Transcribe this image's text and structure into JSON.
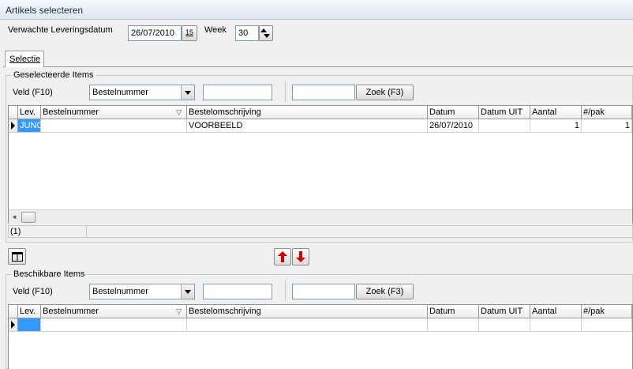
{
  "window": {
    "title": "Artikels selecteren"
  },
  "header": {
    "delivery_label": "Verwachte Leveringsdatum",
    "delivery_value": "26/07/2010",
    "calendar_button": "15",
    "week_label": "Week",
    "week_value": "30"
  },
  "tabs": [
    {
      "label": "Selectie"
    }
  ],
  "selected": {
    "group_title": "Geselecteerde Items",
    "field_label": "Veld (F10)",
    "field_value": "Bestelnummer",
    "search_value": "",
    "search_value2": "",
    "search_button": "Zoek (F3)",
    "columns": [
      "Lev.",
      "Bestelnummer",
      "Bestelomschrijving",
      "Datum",
      "Datum UIT",
      "Aantal",
      "#/pak"
    ],
    "rows": [
      {
        "lev": "JUNC",
        "bestelnummer": "",
        "omschrijving": "VOORBEELD",
        "datum": "26/07/2010",
        "datum_uit": "",
        "aantal": "1",
        "pak": "1"
      }
    ],
    "count": "(1)"
  },
  "available": {
    "group_title": "Beschikbare Items",
    "field_label": "Veld (F10)",
    "field_value": "Bestelnummer",
    "search_value": "",
    "search_value2": "",
    "search_button": "Zoek (F3)",
    "columns": [
      "Lev.",
      "Bestelnummer",
      "Bestelomschrijving",
      "Datum",
      "Datum UIT",
      "Aantal",
      "#/pak"
    ]
  },
  "icons": {
    "move_up": "red-up-arrow-icon",
    "move_down": "red-down-arrow-icon",
    "columns": "columns-icon",
    "calendar": "calendar-icon",
    "spinner": "spinner-icon"
  },
  "colors": {
    "selection": "#3399ff",
    "arrow": "#d40000"
  }
}
